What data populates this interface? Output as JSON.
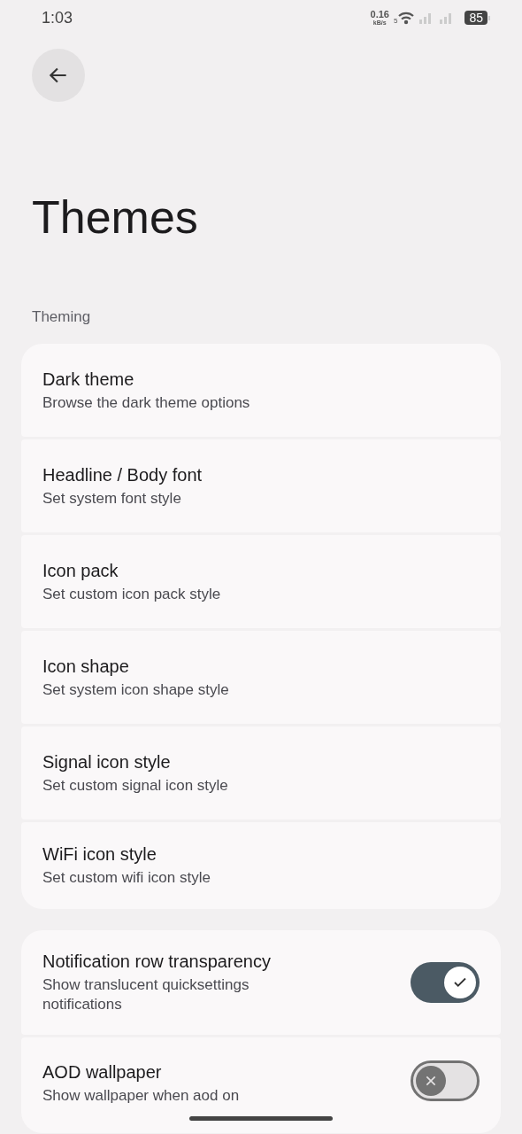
{
  "status_bar": {
    "time": "1:03",
    "net_speed": "0.16",
    "net_unit": "kB/s",
    "wifi_badge": "5",
    "battery": "85"
  },
  "title": "Themes",
  "section": "Theming",
  "groups": [
    {
      "items": [
        {
          "kind": "nav",
          "title": "Dark theme",
          "subtitle": "Browse the dark theme options"
        },
        {
          "kind": "nav",
          "title": "Headline / Body font",
          "subtitle": "Set system font style"
        },
        {
          "kind": "nav",
          "title": "Icon pack",
          "subtitle": "Set custom icon pack style"
        },
        {
          "kind": "nav",
          "title": "Icon shape",
          "subtitle": "Set system icon shape style"
        },
        {
          "kind": "nav",
          "title": "Signal icon style",
          "subtitle": "Set custom signal icon style"
        },
        {
          "kind": "nav",
          "title": "WiFi icon style",
          "subtitle": "Set custom wifi icon style"
        }
      ]
    },
    {
      "items": [
        {
          "kind": "toggle",
          "title": "Notification row transparency",
          "subtitle": "Show translucent quicksettings notifications",
          "on": true
        },
        {
          "kind": "toggle",
          "title": "AOD wallpaper",
          "subtitle": "Show wallpaper when aod on",
          "on": false
        }
      ]
    }
  ]
}
